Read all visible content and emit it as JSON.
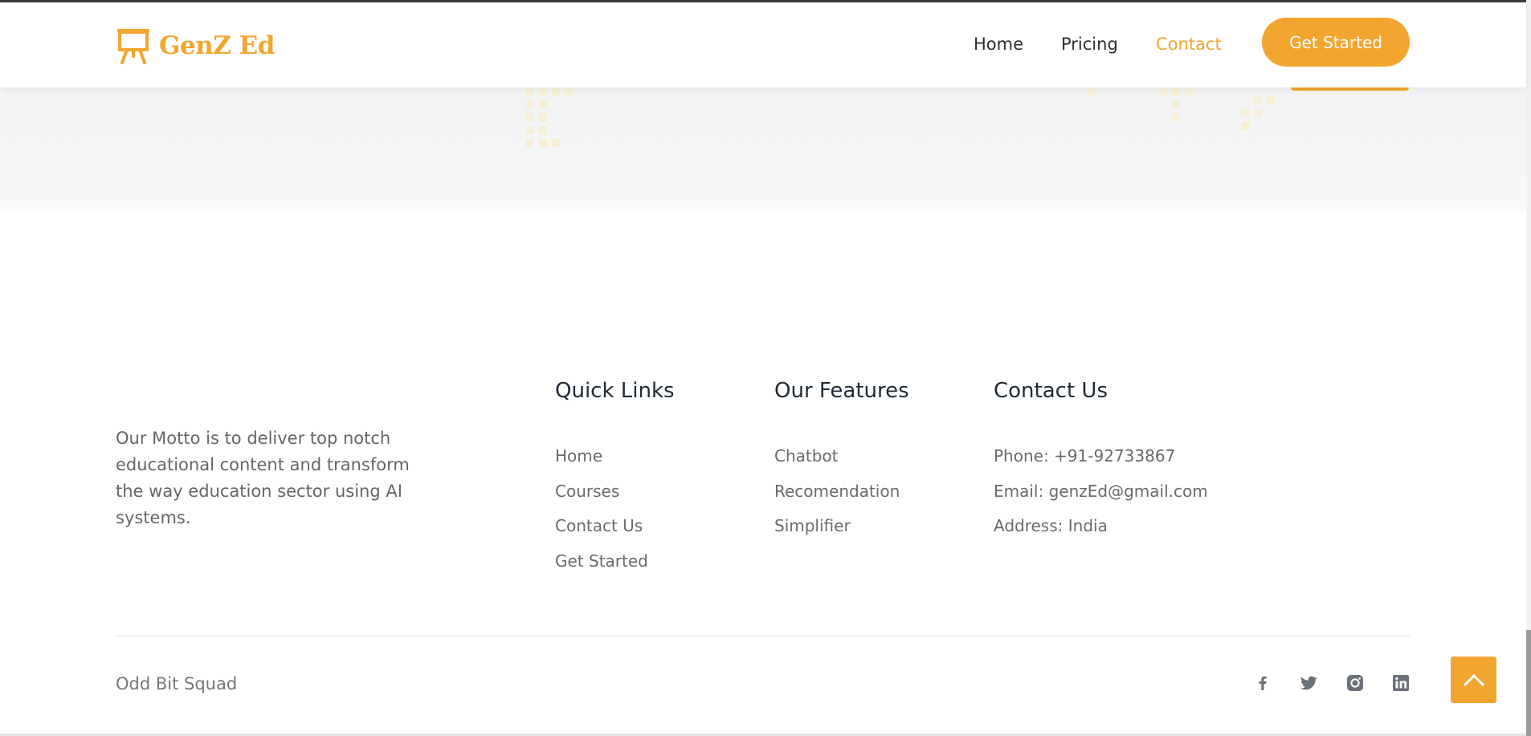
{
  "header": {
    "brand": "GenZ Ed",
    "nav": [
      {
        "label": "Home"
      },
      {
        "label": "Pricing"
      },
      {
        "label": "Contact"
      }
    ],
    "cta_label": "Get Started"
  },
  "footer": {
    "motto": "Our Motto is to deliver top notch educational content and transform the way education sector using AI systems.",
    "quick_links": {
      "title": "Quick Links",
      "items": [
        "Home",
        "Courses",
        "Contact Us",
        "Get Started"
      ]
    },
    "features": {
      "title": "Our Features",
      "items": [
        "Chatbot",
        "Recomendation",
        "Simplifier"
      ]
    },
    "contact": {
      "title": "Contact Us",
      "items": [
        "Phone: +91-92733867",
        "Email: genzEd@gmail.com",
        "Address: India"
      ]
    },
    "credit": "Odd Bit Squad",
    "social_icons": [
      "facebook-icon",
      "twitter-icon",
      "instagram-icon",
      "linkedin-icon"
    ]
  },
  "colors": {
    "accent": "#f2a630",
    "heading": "#1e2a35",
    "text": "#6a6a6a"
  }
}
